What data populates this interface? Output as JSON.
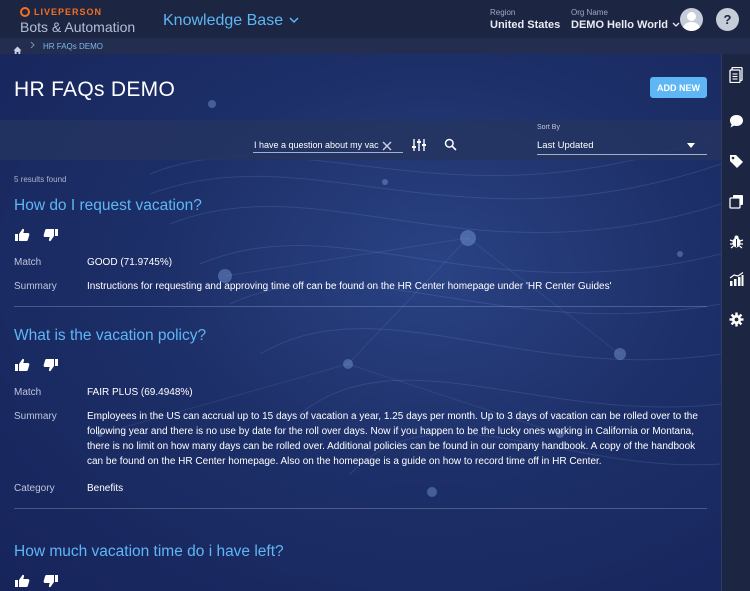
{
  "header": {
    "brand_name": "LIVEPERSON",
    "product_name": "Bots & Automation",
    "section_title": "Knowledge Base",
    "region_label": "Region",
    "region_value": "United States",
    "org_label": "Org Name",
    "org_value": "DEMO Hello World",
    "help_symbol": "?"
  },
  "breadcrumb": {
    "items": [
      "HR FAQs DEMO"
    ]
  },
  "page": {
    "title": "HR FAQs DEMO",
    "add_button_label": "ADD NEW"
  },
  "search": {
    "value": "I have a question about my vac",
    "placeholder": ""
  },
  "sort": {
    "label": "Sort By",
    "selected": "Last Updated"
  },
  "results": {
    "count_text": "5 results found",
    "items": [
      {
        "question": "How do I request vacation?",
        "match_label": "Match",
        "match_value": "GOOD (71.9745%)",
        "summary_label": "Summary",
        "summary": "Instructions for requesting and approving time off can be found on the HR Center homepage under 'HR Center Guides'"
      },
      {
        "question": "What is the vacation policy?",
        "match_label": "Match",
        "match_value": "FAIR PLUS (69.4948%)",
        "summary_label": "Summary",
        "summary": "Employees in the US can accrual up to 15 days of vacation a year, 1.25 days per month. Up to 3 days of vacation can be rolled over to the following year and there is no use by date for the roll over days. Now if you happen to be the lucky ones working in California or Montana, there is no limit on how many days can be rolled over. Additional policies can be found in our company handbook. A copy of the handbook can be found on the HR Center homepage. Also on the homepage is a guide on how to record time off in HR Center.",
        "category_label": "Category",
        "category": "Benefits"
      },
      {
        "question": "How much vacation time do i have left?"
      }
    ]
  },
  "sidebar_icons": [
    "articles-icon",
    "chat-bubble-icon",
    "tag-icon",
    "copy-icon",
    "bug-icon",
    "analytics-icon",
    "settings-gear-icon"
  ],
  "colors": {
    "accent": "#5fb6f5",
    "brand_orange": "#f36f21",
    "header_bg": "#1c2541",
    "content_bg": "#1d2f68"
  }
}
